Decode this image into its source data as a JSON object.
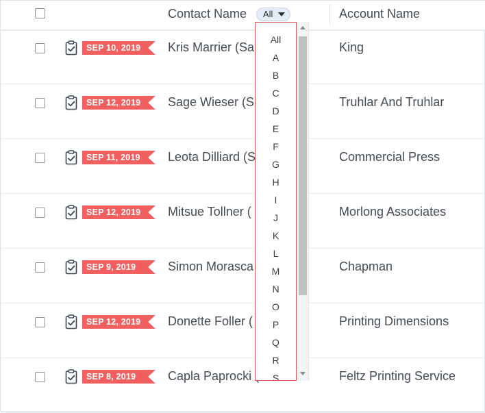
{
  "header": {
    "contact_label": "Contact Name",
    "account_label": "Account Name",
    "filter_value": "All"
  },
  "rows": [
    {
      "date": "SEP 10, 2019",
      "contact": "Kris Marrier (Sa",
      "account": "King"
    },
    {
      "date": "SEP 12, 2019",
      "contact": "Sage Wieser (Sa",
      "account": "Truhlar And Truhlar"
    },
    {
      "date": "SEP 11, 2019",
      "contact": "Leota Dilliard (S",
      "account": "Commercial Press"
    },
    {
      "date": "SEP 12, 2019",
      "contact": "Mitsue Tollner (",
      "account": "Morlong Associates"
    },
    {
      "date": "SEP 9, 2019",
      "contact": "Simon Morasca",
      "account": "Chapman"
    },
    {
      "date": "SEP 12, 2019",
      "contact": "Donette Foller (",
      "account": "Printing Dimensions"
    },
    {
      "date": "SEP 8, 2019",
      "contact": "Capla Paprocki (",
      "account": "Feltz Printing Service"
    }
  ],
  "dropdown": {
    "options": [
      "All",
      "A",
      "B",
      "C",
      "D",
      "E",
      "F",
      "G",
      "H",
      "I",
      "J",
      "K",
      "L",
      "M",
      "N",
      "O",
      "P",
      "Q",
      "R",
      "S"
    ]
  },
  "colors": {
    "date_tag": "#f15f60",
    "dropdown_border": "#e0565a",
    "filter_pill": "#e4edf7"
  },
  "icons": {
    "task": "clipboard-check-icon",
    "filter_caret": "chevron-down-icon"
  }
}
